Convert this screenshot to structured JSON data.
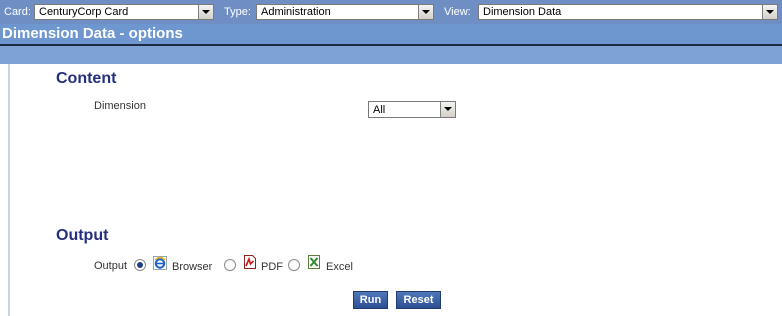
{
  "filters": {
    "card_label": "Card:",
    "card_value": "CenturyCorp Card",
    "type_label": "Type:",
    "type_value": "Administration",
    "view_label": "View:",
    "view_value": "Dimension Data"
  },
  "page": {
    "title": "Dimension Data - options"
  },
  "content": {
    "heading": "Content",
    "dimension_label": "Dimension",
    "dimension_value": "All"
  },
  "output": {
    "heading": "Output",
    "label": "Output",
    "options": [
      {
        "label": "Browser",
        "icon": "browser-icon",
        "selected": true
      },
      {
        "label": "PDF",
        "icon": "pdf-icon",
        "selected": false
      },
      {
        "label": "Excel",
        "icon": "excel-icon",
        "selected": false
      }
    ]
  },
  "actions": {
    "run": "Run",
    "reset": "Reset"
  },
  "colors": {
    "topbar": "#6f8fc4",
    "title_band": "#6f97cf",
    "heading": "#262f7e",
    "button": "#2c4f91"
  }
}
